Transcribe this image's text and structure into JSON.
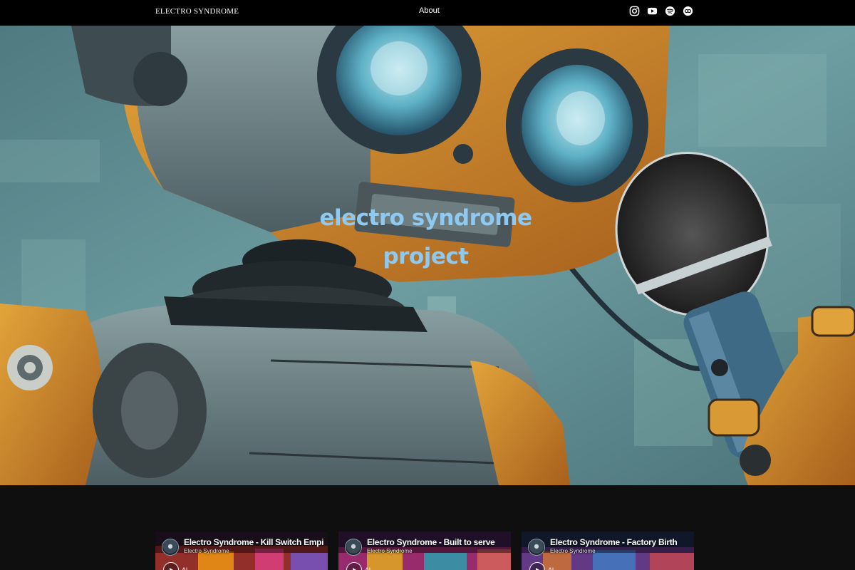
{
  "header": {
    "brand": "ELECTRO SYNDROME",
    "nav": {
      "about_label": "About"
    },
    "socials": [
      {
        "name": "instagram-icon"
      },
      {
        "name": "youtube-icon"
      },
      {
        "name": "spotify-icon"
      },
      {
        "name": "cd-baby-icon"
      }
    ]
  },
  "hero": {
    "title_line1": "electro syndrome",
    "title_line2": "project",
    "title_color": "#8ec9f2"
  },
  "videos": [
    {
      "title": "Electro Syndrome - Kill Switch Empire",
      "channel": "Electro Syndrome",
      "extra": "Al"
    },
    {
      "title": "Electro Syndrome - Built to serve",
      "channel": "Electro Syndrome",
      "extra": "Al"
    },
    {
      "title": "Electro Syndrome - Factory Birth",
      "channel": "Electro Syndrome",
      "extra": "Al"
    }
  ],
  "colors": {
    "background": "#0f0f0f",
    "header": "#000000",
    "accent": "#8ec9f2"
  }
}
